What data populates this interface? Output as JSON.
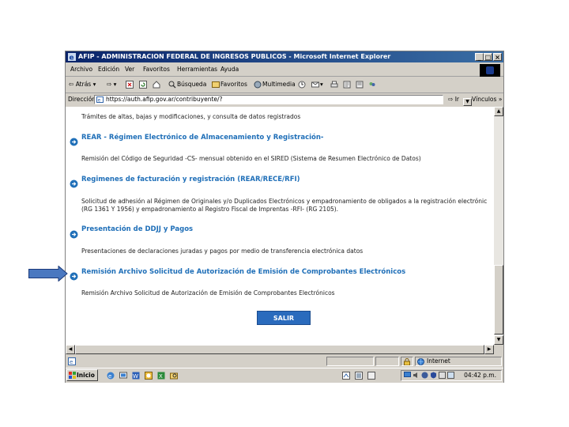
{
  "window": {
    "title": "AFIP - ADMINISTRACION FEDERAL DE INGRESOS PUBLICOS - Microsoft Internet Explorer",
    "minimize_icon": "minimize-icon",
    "maximize_icon": "maximize-icon",
    "close_icon": "close-icon"
  },
  "menu": {
    "items": [
      "Archivo",
      "Edición",
      "Ver",
      "Favoritos",
      "Herramientas",
      "Ayuda"
    ]
  },
  "toolbar": {
    "back": "Atrás",
    "search": "Búsqueda",
    "favorites": "Favoritos",
    "multimedia": "Multimedia"
  },
  "address": {
    "label": "Dirección",
    "url": "https://auth.afip.gov.ar/contribuyente/?",
    "go": "Ir",
    "links": "Vínculos"
  },
  "content": {
    "sections": [
      {
        "heading": "",
        "description": "Trámites de altas, bajas y modificaciones, y consulta de datos registrados"
      },
      {
        "heading": "REAR - Régimen Electrónico de Almacenamiento y Registración-",
        "description": "Remisión del Código de Seguridad -CS- mensual obtenido en el SIRED (Sistema de Resumen Electrónico de Datos)"
      },
      {
        "heading": "Regimenes de facturación y registración (REAR/RECE/RFI)",
        "description": "Solicitud de adhesión al Régimen de Originales y/o Duplicados Electrónicos y empadronamiento de obligados a la registración electrónic",
        "description2": "(RG 1361 Y 1956) y empadronamiento al Registro Fiscal de Imprentas -RFI- (RG 2105)."
      },
      {
        "heading": "Presentación de DDJJ y Pagos",
        "description": "Presentaciones de declaraciones juradas y pagos por medio de transferencia electrónica datos"
      },
      {
        "heading": "Remisión Archivo Solicitud de Autorización de Emisión de Comprobantes Electrónicos",
        "description": "Remisión Archivo Solicitud de Autorización de Emisión de Comprobantes Electrónicos"
      }
    ],
    "exit_button": "SALIR"
  },
  "status": {
    "zone": "Internet"
  },
  "taskbar": {
    "start": "Inicio",
    "clock": "04:42 p.m."
  },
  "colors": {
    "title_bar": "#0a246a",
    "heading": "#1f6fb8",
    "button": "#2a6bbd",
    "pointer": "#4a78c0"
  }
}
